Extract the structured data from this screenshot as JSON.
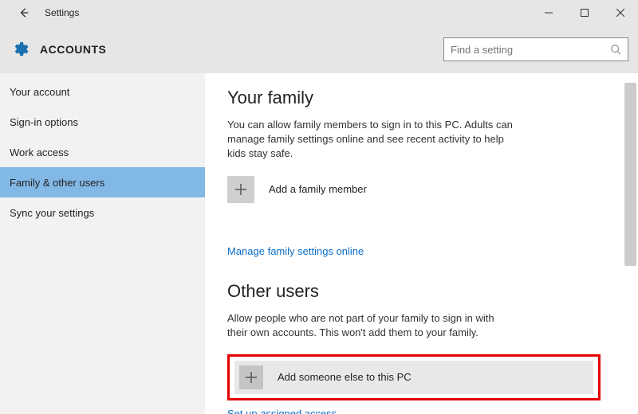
{
  "titlebar": {
    "title": "Settings"
  },
  "header": {
    "title": "ACCOUNTS",
    "search_placeholder": "Find a setting"
  },
  "sidebar": {
    "items": [
      {
        "label": "Your account"
      },
      {
        "label": "Sign-in options"
      },
      {
        "label": "Work access"
      },
      {
        "label": "Family & other users"
      },
      {
        "label": "Sync your settings"
      }
    ],
    "active_index": 3
  },
  "content": {
    "family": {
      "heading": "Your family",
      "desc": "You can allow family members to sign in to this PC. Adults can manage family settings online and see recent activity to help kids stay safe.",
      "add_label": "Add a family member",
      "manage_link": "Manage family settings online"
    },
    "other": {
      "heading": "Other users",
      "desc": "Allow people who are not part of your family to sign in with their own accounts. This won't add them to your family.",
      "add_label": "Add someone else to this PC",
      "assigned_link": "Set up assigned access"
    }
  }
}
